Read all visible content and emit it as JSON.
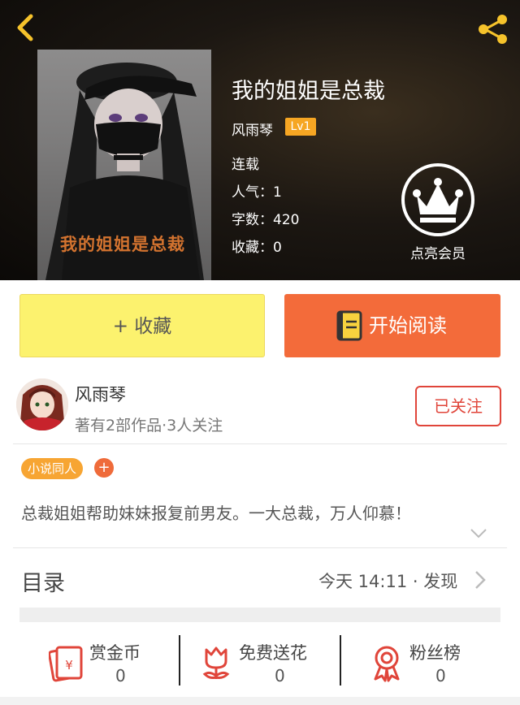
{
  "header": {
    "book_title": "我的姐姐是总裁",
    "author": "风雨琴",
    "level": "Lv1",
    "status": "连载",
    "popularity": "人气：1",
    "word_count": "字数：420",
    "favorites": "收藏：0",
    "member_label": "点亮会员",
    "cover_text": "我的姐姐是总裁"
  },
  "actions": {
    "collect_label": "+ 收藏",
    "read_label": "开始阅读"
  },
  "author_row": {
    "name": "风雨琴",
    "info": "著有2部作品·3人关注",
    "follow_label": "已关注"
  },
  "tags": {
    "tag1": "小说同人",
    "add": "+"
  },
  "description": "总裁姐姐帮助妹妹报复前男友。一大总裁，万人仰慕！",
  "toc": {
    "label": "目录",
    "update": "今天 14:11 · 发现"
  },
  "bottom_stats": [
    {
      "label": "赏金币",
      "value": "0",
      "icon": "red-envelope-icon"
    },
    {
      "label": "免费送花",
      "value": "0",
      "icon": "flower-icon"
    },
    {
      "label": "粉丝榜",
      "value": "0",
      "icon": "medal-icon"
    }
  ],
  "colors": {
    "accent_orange": "#f36b3a",
    "collect_yellow": "#fcf26e",
    "badge_yellow": "#f6a623",
    "follow_red": "#e0453a",
    "icon_red": "#e0453a"
  }
}
